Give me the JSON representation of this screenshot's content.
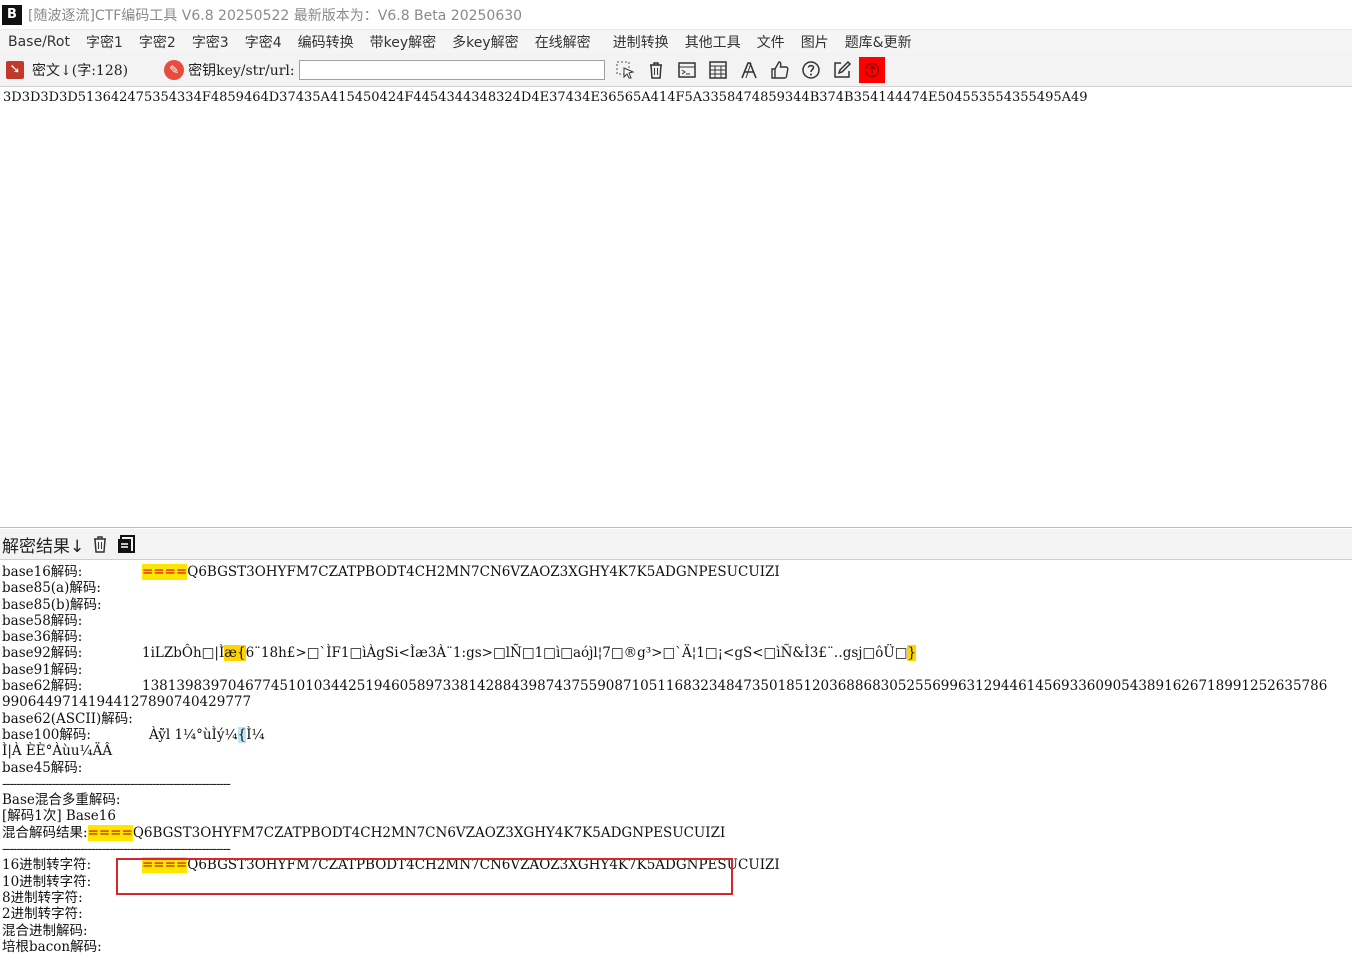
{
  "window": {
    "icon_text": "B",
    "title": "[随波逐流]CTF编码工具 V6.8 20250522     最新版本为：V6.8 Beta 20250630"
  },
  "menu": [
    "Base/Rot",
    "字密1",
    "字密2",
    "字密3",
    "字密4",
    "编码转换",
    "带key解密",
    "多key解密",
    "在线解密",
    "进制转换",
    "其他工具",
    "文件",
    "图片",
    "题库&更新"
  ],
  "toolbar": {
    "cipher_label": "密文↓(字:128)",
    "key_label": "密钥key/str/url:",
    "key_value": "",
    "icons": [
      "cursor-icon",
      "trash-icon",
      "terminal-icon",
      "calculator-icon",
      "font-icon",
      "thumbs-up-icon",
      "help-icon",
      "edit-icon",
      "upload-icon"
    ]
  },
  "cipher_text": "3D3D3D3D513642475354334F4859464D37435A415450424F4454344348324D4E37434E36565A414F5A3358474859344B374B354144474E504553554355495A49",
  "result_bar": {
    "label": "解密结果↓"
  },
  "results": {
    "base16": {
      "label": "base16解码:",
      "prefix": "====",
      "value": "Q6BGST3OHYFM7CZATPBODT4CH2MN7CN6VZAOZ3XGHY4K7K5ADGNPESUCUIZI"
    },
    "base85a": {
      "label": "base85(a)解码:"
    },
    "base85b": {
      "label": "base85(b)解码:"
    },
    "base58": {
      "label": "base58解码:"
    },
    "base36": {
      "label": "base36解码:"
    },
    "base92": {
      "label": "base92解码:",
      "pre": "1iLZbÔh□|Ì",
      "hl1": "æ{",
      "mid": "6¨18h£>□`ÌF1□ìÀgSi<Ìæ3À¨1:gs>□lÑ□1□ì□aój̀l¦7□®g³>□`Ä¦1□¡<gS<□ìÑ&Ì3£¨‥gsj□ôÜ□",
      "hl2": "}"
    },
    "base91": {
      "label": "base91解码:"
    },
    "base62": {
      "label": "base62解码:",
      "value": "138139839704677451010344251946058973381428843987437559087105116832348473501851203688683052556996312944614569336090543891626718991252635786",
      "value_cont": "99064497141944127890740429777"
    },
    "base62ascii": {
      "label": "base62(ASCII)解码:"
    },
    "base100": {
      "label": "base100解码:",
      "pre": "Àÿ̀l 1¼°ùÌý¼",
      "hl": "{",
      "post": "Ì¼",
      "cont": "Ì|À ÈÈ°Àùu¼ÄÂ"
    },
    "base45": {
      "label": "base45解码:"
    },
    "separator": "----------------------------------------------------------------",
    "multi_label": "Base混合多重解码:",
    "multi_step": "[解码1次] Base16",
    "mixed_label": "混合解码结果:",
    "mixed_prefix": "====",
    "mixed_value": "Q6BGST3OHYFM7CZATPBODT4CH2MN7CN6VZAOZ3XGHY4K7K5ADGNPESUCUIZI",
    "hex_label": "16进制转字符:",
    "hex_prefix": "====",
    "hex_value": "Q6BGST3OHYFM7CZATPBODT4CH2MN7CN6VZAOZ3XGHY4K7K5ADGNPESUCUIZI",
    "dec_label": "10进制转字符:",
    "oct_label": "8进制转字符:",
    "bin_label": "2进制转字符:",
    "mixed_radix_label": "混合进制解码:",
    "bacon_label": "培根bacon解码:"
  },
  "colors": {
    "highlight": "#ffe600",
    "highlight_text": "#d00000",
    "box": "#d9262c",
    "upload_bg": "#ff0000"
  }
}
